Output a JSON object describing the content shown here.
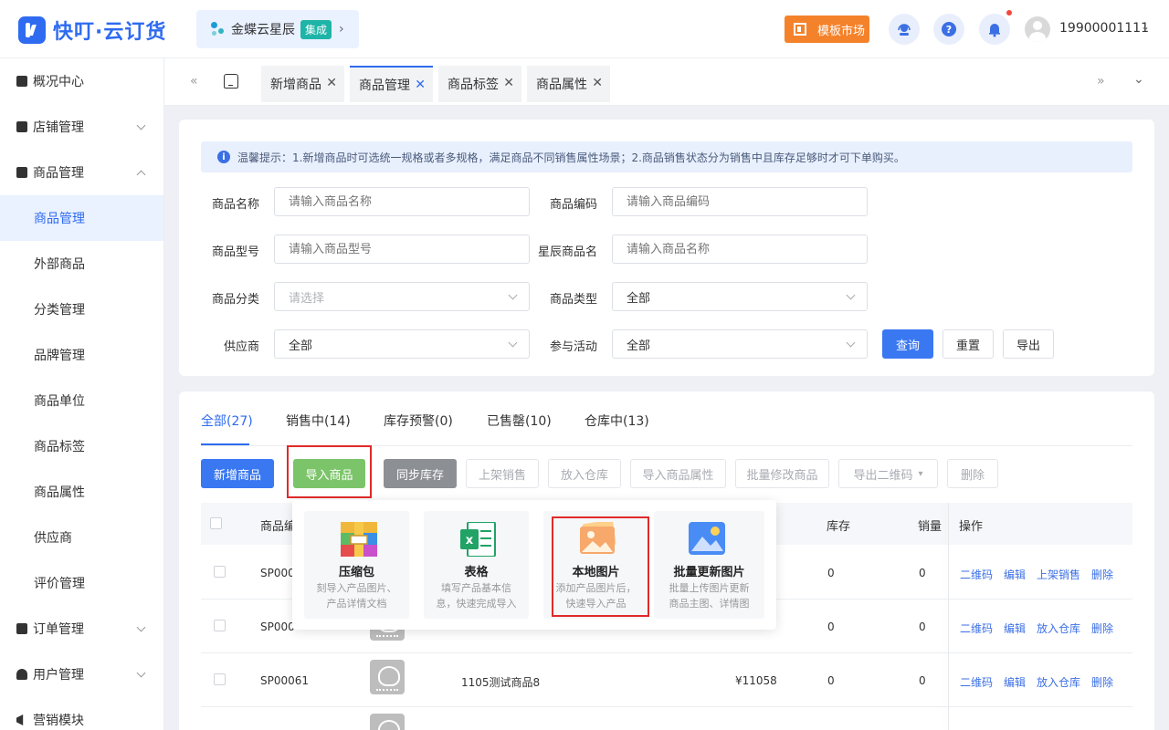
{
  "header": {
    "logo_text": "快叮·云订货",
    "brand_name": "金蝶云星辰",
    "brand_badge": "集成",
    "brand_chevron": "›",
    "market_label": "模板市场",
    "username": "19900001111",
    "user_chevron": "⌄"
  },
  "sidebar": {
    "groups": [
      {
        "label": "概况中心"
      },
      {
        "label": "店铺管理"
      },
      {
        "label": "商品管理"
      },
      {
        "label": "订单管理"
      },
      {
        "label": "用户管理"
      },
      {
        "label": "营销模块"
      }
    ],
    "subitems": [
      {
        "label": "商品管理"
      },
      {
        "label": "外部商品"
      },
      {
        "label": "分类管理"
      },
      {
        "label": "品牌管理"
      },
      {
        "label": "商品单位"
      },
      {
        "label": "商品标签"
      },
      {
        "label": "商品属性"
      },
      {
        "label": "供应商"
      },
      {
        "label": "评价管理"
      }
    ]
  },
  "tabs": {
    "left_arrow": "«",
    "right_arrow": "»",
    "down_arrow": "⌄",
    "items": [
      {
        "label": "新增商品"
      },
      {
        "label": "商品管理"
      },
      {
        "label": "商品标签"
      },
      {
        "label": "商品属性"
      }
    ],
    "close": "✕"
  },
  "search": {
    "tip_icon": "i",
    "tip": "温馨提示：1.新增商品时可选统一规格或者多规格，满足商品不同销售属性场景；2.商品销售状态分为销售中且库存足够时才可下单购买。",
    "fields": {
      "name_label": "商品名称",
      "name_ph": "请输入商品名称",
      "code_label": "商品编码",
      "code_ph": "请输入商品编码",
      "model_label": "商品型号",
      "model_ph": "请输入商品型号",
      "xc_label": "星辰商品名",
      "xc_ph": "请输入商品名称",
      "cat_label": "商品分类",
      "cat_ph": "请选择",
      "type_label": "商品类型",
      "type_val": "全部",
      "supplier_label": "供应商",
      "supplier_val": "全部",
      "activity_label": "参与活动",
      "activity_val": "全部"
    },
    "query": "查询",
    "reset": "重置",
    "export": "导出"
  },
  "status_tabs": [
    {
      "label": "全部(27)"
    },
    {
      "label": "销售中(14)"
    },
    {
      "label": "库存预警(0)"
    },
    {
      "label": "已售罄(10)"
    },
    {
      "label": "仓库中(13)"
    }
  ],
  "actions": {
    "add": "新增商品",
    "import": "导入商品",
    "sync": "同步库存",
    "on_sale": "上架销售",
    "to_warehouse": "放入仓库",
    "import_attr": "导入商品属性",
    "batch_edit": "批量修改商品",
    "export_qr": "导出二维码",
    "delete": "删除"
  },
  "table": {
    "headers": {
      "code": "商品编",
      "stock": "库存",
      "sales": "销量",
      "ops": "操作"
    },
    "rows": [
      {
        "code": "SP000",
        "name": "",
        "price": "",
        "stock": "0",
        "sales": "0",
        "ops": [
          "二维码",
          "编辑",
          "上架销售",
          "删除"
        ]
      },
      {
        "code": "SP000",
        "name": "",
        "price": "",
        "stock": "0",
        "sales": "0",
        "ops": [
          "二维码",
          "编辑",
          "放入仓库",
          "删除"
        ]
      },
      {
        "code": "SP00061",
        "name": "1105测试商品8",
        "price": "¥11058",
        "stock": "0",
        "sales": "0",
        "ops": [
          "二维码",
          "编辑",
          "放入仓库",
          "删除"
        ]
      }
    ]
  },
  "import_menu": [
    {
      "title": "压缩包",
      "desc": "刻导入产品图片、\n产品详情文档",
      "icon": "zip-archive-icon"
    },
    {
      "title": "表格",
      "desc": "填写产品基本信\n息，快速完成导入",
      "icon": "excel-sheet-icon"
    },
    {
      "title": "本地图片",
      "desc": "添加产品图片后，\n快速导入产品",
      "icon": "local-image-icon"
    },
    {
      "title": "批量更新图片",
      "desc": "批量上传图片更新\n商品主图、详情图",
      "icon": "batch-image-icon"
    }
  ],
  "colors": {
    "primary": "#3a78f2",
    "import_green": "#7cc46a",
    "highlight_red": "#e02a2a",
    "market_orange": "#f4822b"
  }
}
